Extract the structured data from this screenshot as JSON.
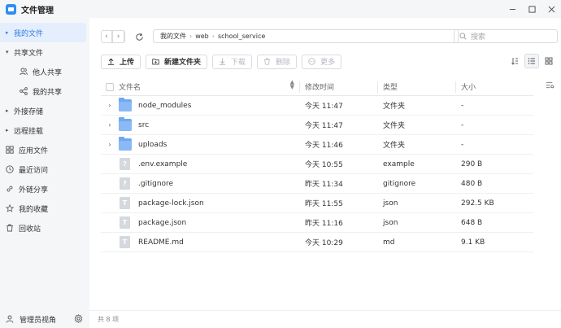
{
  "window": {
    "title": "文件管理",
    "controls": [
      "minimize-icon",
      "maximize-icon",
      "close-icon"
    ]
  },
  "sidebar": {
    "items": [
      {
        "label": "我的文件",
        "icon": "caret-right-icon",
        "active": true
      },
      {
        "label": "共享文件",
        "icon": "caret-down-icon"
      },
      {
        "label": "他人共享",
        "icon": "users-icon",
        "sub": true
      },
      {
        "label": "我的共享",
        "icon": "share-icon",
        "sub": true
      },
      {
        "label": "外接存储",
        "icon": "caret-right-icon"
      },
      {
        "label": "远程挂载",
        "icon": "caret-right-icon"
      },
      {
        "label": "应用文件",
        "icon": "apps-icon"
      },
      {
        "label": "最近访问",
        "icon": "clock-icon"
      },
      {
        "label": "外链分享",
        "icon": "link-icon"
      },
      {
        "label": "我的收藏",
        "icon": "star-icon"
      },
      {
        "label": "回收站",
        "icon": "trash-icon"
      }
    ],
    "footer": {
      "label": "管理员视角",
      "icon": "admin-user-icon",
      "settings_icon": "gear-icon"
    }
  },
  "addressbar": {
    "path": [
      "我的文件",
      "web",
      "school_service"
    ],
    "search_placeholder": "搜索"
  },
  "toolbar": {
    "upload": "上传",
    "new_folder": "新建文件夹",
    "download": "下载",
    "delete": "删除",
    "more": "更多"
  },
  "table": {
    "headers": {
      "name": "文件名",
      "modified": "修改时间",
      "type": "类型",
      "size": "大小"
    },
    "rows": [
      {
        "name": "node_modules",
        "modified": "今天 11:47",
        "type": "文件夹",
        "size": "-",
        "kind": "folder",
        "expandable": true
      },
      {
        "name": "src",
        "modified": "今天 11:47",
        "type": "文件夹",
        "size": "-",
        "kind": "folder",
        "expandable": true
      },
      {
        "name": "uploads",
        "modified": "今天 11:46",
        "type": "文件夹",
        "size": "-",
        "kind": "folder",
        "expandable": true
      },
      {
        "name": ".env.example",
        "modified": "今天 10:55",
        "type": "example",
        "size": "290 B",
        "kind": "unknown-file"
      },
      {
        "name": ".gitignore",
        "modified": "昨天 11:34",
        "type": "gitignore",
        "size": "480 B",
        "kind": "unknown-file"
      },
      {
        "name": "package-lock.json",
        "modified": "昨天 11:55",
        "type": "json",
        "size": "292.5 KB",
        "kind": "text-file"
      },
      {
        "name": "package.json",
        "modified": "昨天 11:16",
        "type": "json",
        "size": "648 B",
        "kind": "text-file"
      },
      {
        "name": "README.md",
        "modified": "今天 10:29",
        "type": "md",
        "size": "9.1 KB",
        "kind": "text-file"
      }
    ]
  },
  "status": {
    "count": "共 8 项"
  },
  "colors": {
    "accent": "#2f7be5",
    "folder": "#6ea8f3",
    "sidebar_bg": "#f5f6f8"
  }
}
